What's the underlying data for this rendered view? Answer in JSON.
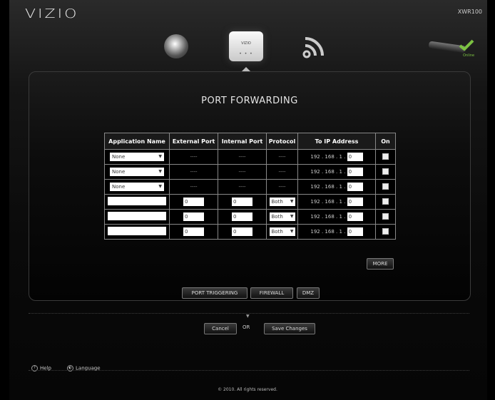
{
  "header": {
    "brand": "VIZIO",
    "model": "XWR100"
  },
  "nav": {
    "router_label": "VIZIO",
    "router_dots": "• • •",
    "status_label": "Online"
  },
  "page": {
    "title": "PORT FORWARDING"
  },
  "table": {
    "headers": [
      "Application Name",
      "External Port",
      "Internal Port",
      "Protocol",
      "To IP Address",
      "On"
    ],
    "ip_prefix": "192 . 168 . 1 .",
    "preset_rows": [
      {
        "application": "None",
        "external": "----",
        "internal": "----",
        "protocol": "----",
        "ip_last": "0"
      },
      {
        "application": "None",
        "external": "----",
        "internal": "----",
        "protocol": "----",
        "ip_last": "0"
      },
      {
        "application": "None",
        "external": "----",
        "internal": "----",
        "protocol": "----",
        "ip_last": "0"
      }
    ],
    "custom_rows": [
      {
        "name": "",
        "external": "0",
        "internal": "0",
        "protocol": "Both",
        "ip_last": "0"
      },
      {
        "name": "",
        "external": "0",
        "internal": "0",
        "protocol": "Both",
        "ip_last": "0"
      },
      {
        "name": "",
        "external": "0",
        "internal": "0",
        "protocol": "Both",
        "ip_last": "0"
      }
    ]
  },
  "buttons": {
    "more": "MORE",
    "port_triggering": "PORT TRIGGERING",
    "firewall": "FIREWALL",
    "dmz": "DMZ",
    "cancel": "Cancel",
    "or": "OR",
    "save": "Save Changes"
  },
  "footer": {
    "help": "Help",
    "language": "Language",
    "copyright": "© 2010. All rights reserved."
  },
  "colors": {
    "online_green": "#7cc242",
    "background": "#000000"
  },
  "icons": [
    "globe-icon",
    "router-icon",
    "wifi-icon",
    "device-icon",
    "checkmark-icon",
    "help-icon",
    "language-icon"
  ]
}
